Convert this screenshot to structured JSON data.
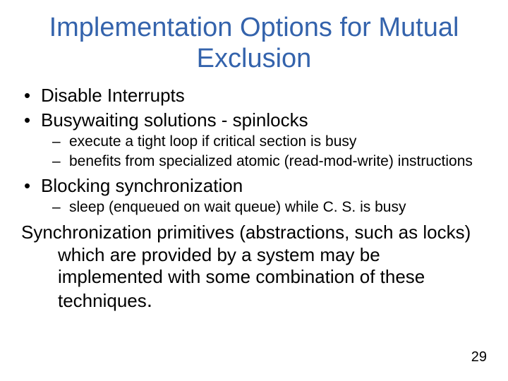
{
  "title": "Implementation Options for Mutual Exclusion",
  "bullets": {
    "b1": "Disable Interrupts",
    "b2": "Busywaiting solutions - spinlocks",
    "b2_1": "execute a tight loop if critical section is busy",
    "b2_2": "benefits from specialized atomic (read-mod-write) instructions",
    "b3": "Blocking synchronization",
    "b3_1": "sleep (enqueued on wait queue) while C. S. is busy"
  },
  "paragraph": "Synchronization primitives (abstractions, such as locks) which are provided by a system may be implemented with some combination of these techniques",
  "paragraph_dot": ".",
  "markers": {
    "l1": "•",
    "l2": "–"
  },
  "page_number": "29"
}
